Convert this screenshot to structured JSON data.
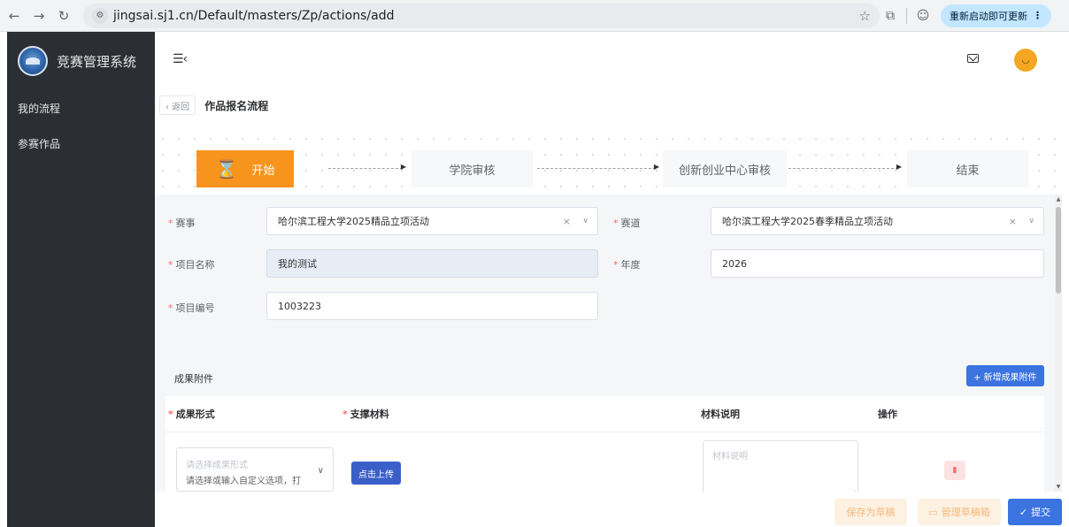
{
  "browser": {
    "url": "jingsai.sj1.cn/Default/masters/Zp/actions/add",
    "update_label": "重新启动即可更新"
  },
  "sidebar": {
    "app_title": "竞赛管理系统",
    "items": [
      {
        "label": "我的流程"
      },
      {
        "label": "参赛作品"
      }
    ]
  },
  "header": {
    "menu_toggle": "☰‹"
  },
  "breadcrumb": {
    "back_label": "‹ 返回",
    "title": "作品报名流程"
  },
  "steps": [
    {
      "label": "开始",
      "active": true
    },
    {
      "label": "学院审核",
      "active": false
    },
    {
      "label": "创新创业中心审核",
      "active": false
    },
    {
      "label": "结束",
      "active": false
    }
  ],
  "form": {
    "event_label": "赛事",
    "event_value": "哈尔滨工程大学2025精品立项活动",
    "track_label": "赛道",
    "track_value": "哈尔滨工程大学2025春季精品立项活动",
    "project_name_label": "项目名称",
    "project_name_value": "我的测试",
    "year_label": "年度",
    "year_value": "2026",
    "project_no_label": "项目编号",
    "project_no_value": "1003223"
  },
  "attachments": {
    "section_title": "成果附件",
    "add_button": "+ 新增成果附件",
    "columns": [
      "成果形式",
      "支撑材料",
      "材料说明",
      "操作"
    ],
    "row": {
      "form_placeholder": "请选择成果形式",
      "form_hint": "请选择或输入自定义选项，打",
      "upload_label": "点击上传",
      "desc_placeholder": "材料说明"
    }
  },
  "footer": {
    "save_draft": "保存为草稿",
    "manage_drafts": "管理草稿箱",
    "submit": "提交"
  },
  "colors": {
    "sidebar_bg": "#2b2e33",
    "accent_orange": "#f7941d",
    "primary_blue": "#3b73e0",
    "required_red": "#f56c6c"
  }
}
